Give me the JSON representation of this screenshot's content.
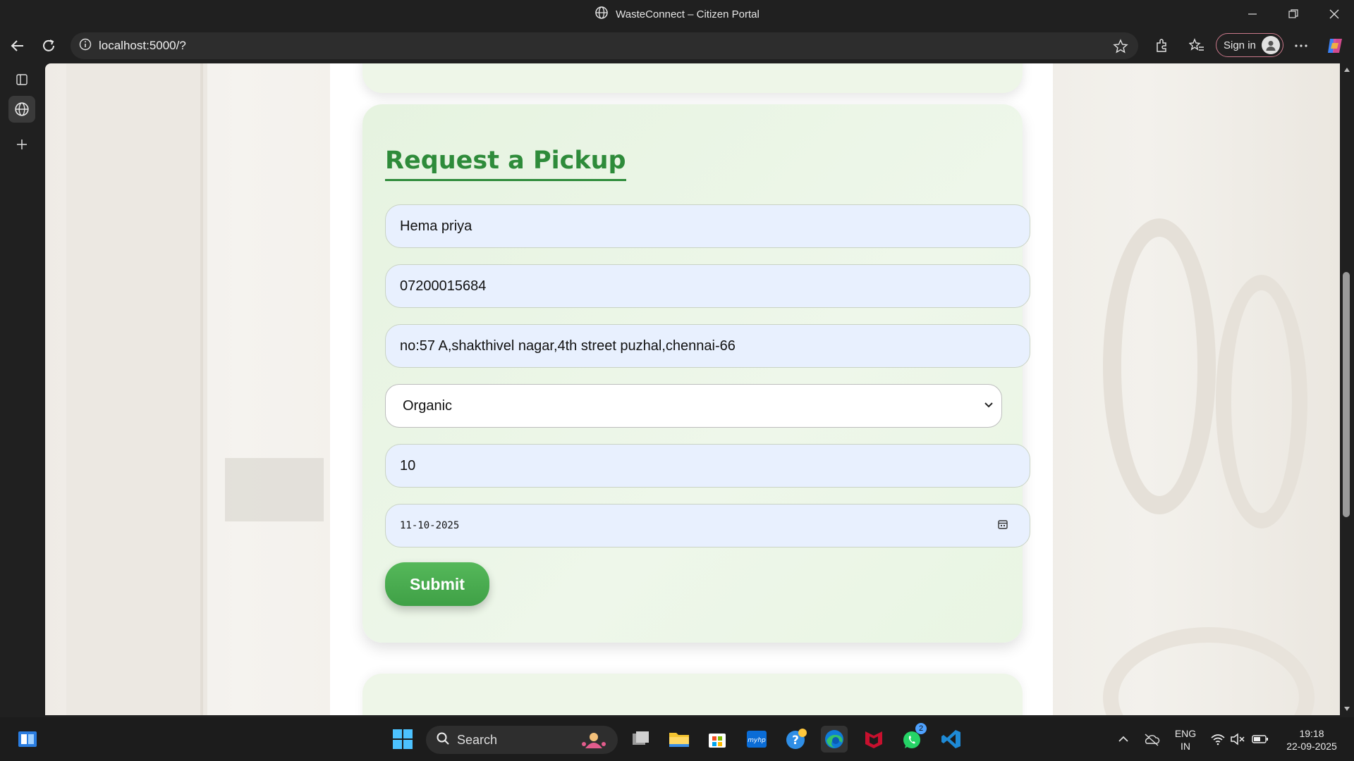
{
  "window": {
    "title": "WasteConnect – Citizen Portal"
  },
  "browser": {
    "url": "localhost:5000/?",
    "signin_label": "Sign in"
  },
  "form": {
    "heading": "Request a Pickup",
    "name_value": "Hema priya",
    "phone_value": "07200015684",
    "address_value": "no:57 A,shakthivel nagar,4th street puzhal,chennai-66",
    "waste_type_selected": "Organic",
    "quantity_value": "10",
    "date_value": "11-10-2025",
    "submit_label": "Submit"
  },
  "taskbar": {
    "search_label": "Search",
    "whatsapp_badge": "2",
    "lang_line1": "ENG",
    "lang_line2": "IN",
    "time": "19:18",
    "date": "22-09-2025"
  },
  "colors": {
    "accent_green": "#2e8b3a",
    "button_green": "#4caf50",
    "input_fill": "#e8f0fe"
  }
}
